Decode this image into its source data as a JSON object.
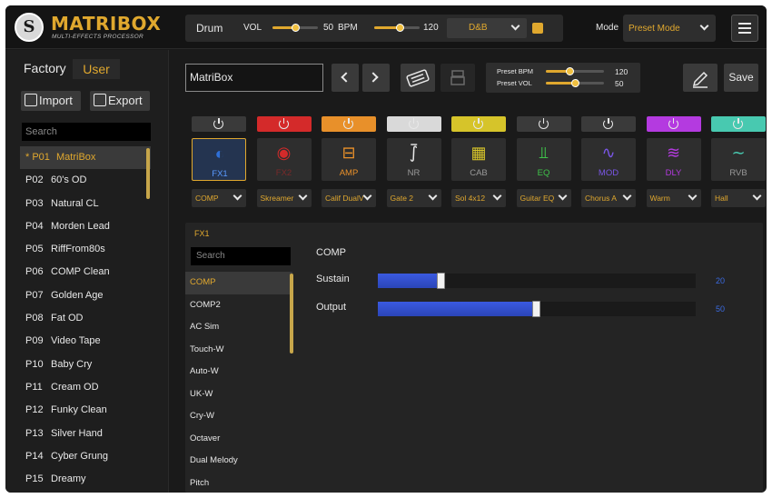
{
  "app": {
    "brand": "MATRIBOX",
    "tagline": "MULTI-EFFECTS PROCESSOR"
  },
  "drum": {
    "label": "Drum",
    "vol_label": "VOL",
    "vol_value": "50",
    "vol_level": 0.5,
    "bpm_label": "BPM",
    "bpm_value": "120",
    "bpm_level": 0.55,
    "style": "D&B"
  },
  "mode": {
    "label": "Mode",
    "value": "Preset Mode"
  },
  "left": {
    "tab_factory": "Factory",
    "tab_user": "User",
    "import_label": "Import",
    "export_label": "Export",
    "search_placeholder": "Search",
    "presets": [
      {
        "num": "* P01",
        "name": "MatriBox"
      },
      {
        "num": "P02",
        "name": "60's OD"
      },
      {
        "num": "P03",
        "name": "Natural CL"
      },
      {
        "num": "P04",
        "name": "Morden Lead"
      },
      {
        "num": "P05",
        "name": "RiffFrom80s"
      },
      {
        "num": "P06",
        "name": "COMP Clean"
      },
      {
        "num": "P07",
        "name": "Golden Age"
      },
      {
        "num": "P08",
        "name": "Fat OD"
      },
      {
        "num": "P09",
        "name": "Video Tape"
      },
      {
        "num": "P10",
        "name": "Baby Cry"
      },
      {
        "num": "P11",
        "name": "Cream OD"
      },
      {
        "num": "P12",
        "name": "Funky Clean"
      },
      {
        "num": "P13",
        "name": "Silver Hand"
      },
      {
        "num": "P14",
        "name": "Cyber Grung"
      },
      {
        "num": "P15",
        "name": "Dreamy"
      }
    ]
  },
  "preset": {
    "name": "MatriBox",
    "bpm_label": "Preset BPM",
    "bpm_value": "120",
    "bpm_level": 0.4,
    "vol_label": "Preset VOL",
    "vol_value": "50",
    "vol_level": 0.5,
    "save_label": "Save"
  },
  "chain": [
    {
      "name": "FX1",
      "icon": "compressor-icon",
      "glyph": "◐",
      "power_color": "#3a3a3a",
      "color": "#2f6fd6",
      "selection": "COMP",
      "selected": true
    },
    {
      "name": "FX2",
      "icon": "record-icon",
      "glyph": "◉",
      "power_color": "#d42a2a",
      "color": "#d42a2a",
      "selection": "Skreamer",
      "selected": false
    },
    {
      "name": "AMP",
      "icon": "amp-icon",
      "glyph": "⊟",
      "power_color": "#e8902a",
      "color": "#e8902a",
      "selection": "Calif DualV",
      "selected": false
    },
    {
      "name": "NR",
      "icon": "noise-gate-icon",
      "glyph": "⨛",
      "power_color": "#d9d9d9",
      "color": "#e8e8e8",
      "selection": "Gate 2",
      "selected": false
    },
    {
      "name": "CAB",
      "icon": "cabinet-icon",
      "glyph": "▦",
      "power_color": "#d6c42a",
      "color": "#d6c42a",
      "selection": "Sol 4x12",
      "selected": false
    },
    {
      "name": "EQ",
      "icon": "eq-sliders-icon",
      "glyph": "⫫",
      "power_color": "#3a3a3a",
      "color": "#3fc24a",
      "selection": "Guitar EQ",
      "selected": false
    },
    {
      "name": "MOD",
      "icon": "modulation-wave-icon",
      "glyph": "∿",
      "power_color": "#3a3a3a",
      "color": "#7a56e6",
      "selection": "Chorus A",
      "selected": false
    },
    {
      "name": "DLY",
      "icon": "delay-wave-icon",
      "glyph": "≋",
      "power_color": "#b43ae0",
      "color": "#b43ae0",
      "selection": "Warm",
      "selected": false
    },
    {
      "name": "RVB",
      "icon": "reverb-wave-icon",
      "glyph": "∼",
      "power_color": "#48c9b0",
      "color": "#48c9b0",
      "selection": "Hall",
      "selected": false
    }
  ],
  "editor": {
    "slot_label": "FX1",
    "search_placeholder": "Search",
    "effects": [
      "COMP",
      "COMP2",
      "AC Sim",
      "Touch-W",
      "Auto-W",
      "UK-W",
      "Cry-W",
      "Octaver",
      "Dual Melody",
      "Pitch"
    ],
    "selected_effect": "COMP",
    "title": "COMP",
    "params": [
      {
        "name": "Sustain",
        "value": "20",
        "level": 0.2
      },
      {
        "name": "Output",
        "value": "50",
        "level": 0.5
      }
    ]
  },
  "colors": {
    "accent": "#e0a82e",
    "background": "#1a1a1a",
    "param_blue": "#3a5ae0"
  }
}
